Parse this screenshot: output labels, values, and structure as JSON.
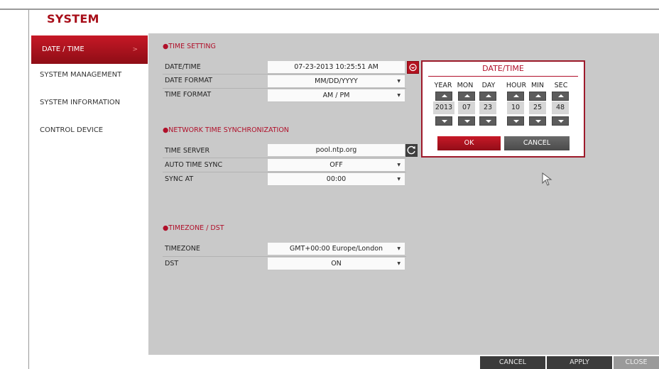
{
  "title": "SYSTEM",
  "sidebar": {
    "items": [
      {
        "label": "DATE / TIME"
      },
      {
        "label": "SYSTEM MANAGEMENT"
      },
      {
        "label": "SYSTEM INFORMATION"
      },
      {
        "label": "CONTROL DEVICE"
      }
    ]
  },
  "time_setting": {
    "title": "●TIME SETTING",
    "date_time_label": "DATE/TIME",
    "date_time_value": "07-23-2013 10:25:51 AM",
    "date_format_label": "DATE FORMAT",
    "date_format_value": "MM/DD/YYYY",
    "time_format_label": "TIME FORMAT",
    "time_format_value": "AM / PM"
  },
  "network_sync": {
    "title": "●NETWORK TIME SYNCHRONIZATION",
    "server_label": "TIME SERVER",
    "server_value": "pool.ntp.org",
    "auto_label": "AUTO TIME SYNC",
    "auto_value": "OFF",
    "sync_at_label": "SYNC AT",
    "sync_at_value": "00:00"
  },
  "timezone": {
    "title": "●TIMEZONE / DST",
    "tz_label": "TIMEZONE",
    "tz_value": "GMT+00:00 Europe/London",
    "dst_label": "DST",
    "dst_value": "ON"
  },
  "popup": {
    "title": "DATE/TIME",
    "columns": [
      {
        "label": "YEAR",
        "value": "2013"
      },
      {
        "label": "MON",
        "value": "07"
      },
      {
        "label": "DAY",
        "value": "23"
      },
      {
        "label": "HOUR",
        "value": "10"
      },
      {
        "label": "MIN",
        "value": "25"
      },
      {
        "label": "SEC",
        "value": "48"
      }
    ],
    "ok_label": "OK",
    "cancel_label": "CANCEL"
  },
  "footer": {
    "cancel_label": "CANCEL",
    "apply_label": "APPLY",
    "close_label": "CLOSE"
  },
  "colors": {
    "accent": "#b0102a",
    "panel_bg": "#c9c9c9"
  }
}
